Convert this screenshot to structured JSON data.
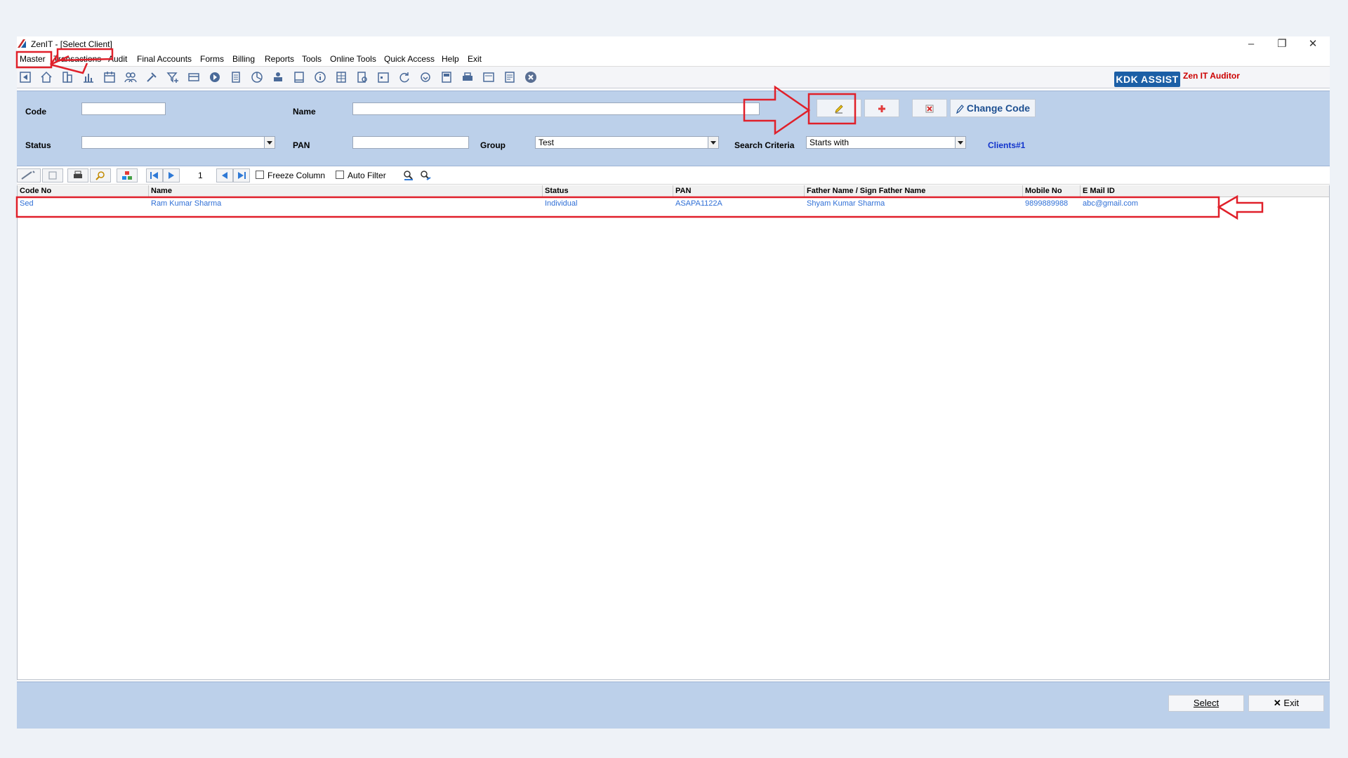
{
  "window": {
    "title": "ZenIT - [Select Client]",
    "controls": [
      "–",
      "❐",
      "✕"
    ]
  },
  "menu": [
    "Master",
    "Transactions",
    "Audit",
    "Final Accounts",
    "Forms",
    "Billing",
    "Reports",
    "Tools",
    "Online Tools",
    "Quick Access",
    "Help",
    "Exit"
  ],
  "toolbar": {
    "brand_button": "KDK ASSIST",
    "brand_text": "Zen IT Auditor"
  },
  "filters": {
    "code_label": "Code",
    "code_value": "",
    "name_label": "Name",
    "name_value": "",
    "status_label": "Status",
    "status_value": "",
    "pan_label": "PAN",
    "pan_value": "",
    "group_label": "Group",
    "group_value": "Test",
    "search_label": "Search Criteria",
    "search_value": "Starts with",
    "clients_count": "Clients#1",
    "change_code_label": "Change Code"
  },
  "grid_toolbar": {
    "page_number": "1",
    "freeze_label": "Freeze Column",
    "autofilter_label": "Auto Filter"
  },
  "table": {
    "columns": [
      "Code No",
      "Name",
      "Status",
      "PAN",
      "Father Name / Sign Father Name",
      "Mobile No",
      "E Mail ID"
    ],
    "rows": [
      [
        "Sed",
        "Ram Kumar Sharma",
        "Individual",
        "ASAPA1122A",
        "Shyam Kumar Sharma",
        "9899889988",
        "abc@gmail.com"
      ]
    ]
  },
  "footer": {
    "select_label": "Select",
    "exit_label": "Exit"
  },
  "colors": {
    "panel": "#bcd0ea",
    "accent": "#1c5fa6",
    "link": "#2f6fd6",
    "annotation": "#e0202a"
  }
}
